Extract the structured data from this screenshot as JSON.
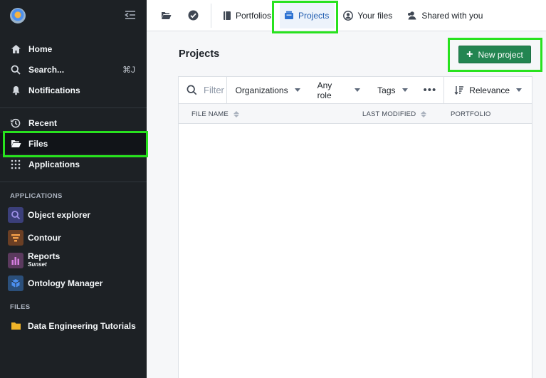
{
  "sidebar": {
    "nav": [
      {
        "label": "Home",
        "icon": "home-icon"
      },
      {
        "label": "Search...",
        "icon": "search-icon",
        "shortcut": "⌘J"
      },
      {
        "label": "Notifications",
        "icon": "bell-icon"
      }
    ],
    "nav2": [
      {
        "label": "Recent",
        "icon": "history-icon"
      },
      {
        "label": "Files",
        "icon": "folder-open-icon"
      },
      {
        "label": "Applications",
        "icon": "grid-icon"
      }
    ],
    "applications_heading": "APPLICATIONS",
    "apps": [
      {
        "label": "Object explorer",
        "color": "#3b3f7a"
      },
      {
        "label": "Contour",
        "color": "#6b3f24"
      },
      {
        "label": "Reports",
        "sub": "Sunset",
        "color": "#5b3a5e"
      },
      {
        "label": "Ontology Manager",
        "color": "#2b4f7a"
      }
    ],
    "files_heading": "FILES",
    "files": [
      {
        "label": "Data Engineering Tutorials",
        "color": "#f0b429"
      }
    ]
  },
  "topbar": {
    "tabs": [
      {
        "label": "Portfolios"
      },
      {
        "label": "Projects",
        "active": true
      },
      {
        "label": "Your files"
      },
      {
        "label": "Shared with you"
      }
    ]
  },
  "main": {
    "title": "Projects",
    "new_button": "New project",
    "search_placeholder": "Filter",
    "filters": [
      "Organizations",
      "Any role",
      "Tags"
    ],
    "more": "•••",
    "sort": "Relevance",
    "columns": [
      "FILE NAME",
      "LAST MODIFIED",
      "PORTFOLIO"
    ]
  },
  "colors": {
    "highlight": "#28e21e",
    "primary_green": "#238551",
    "active_tab": "#215db0",
    "sidebar_bg": "#1d2125"
  }
}
